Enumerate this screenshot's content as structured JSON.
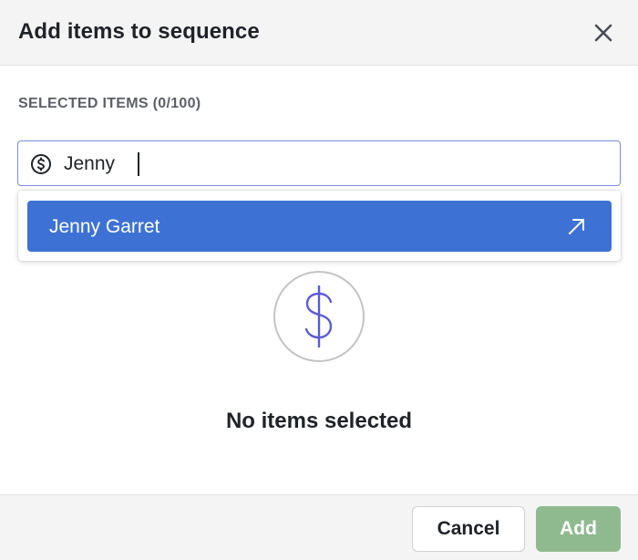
{
  "dialog": {
    "title": "Add items to sequence",
    "close_icon": "close-icon"
  },
  "selection": {
    "label": "SELECTED ITEMS (0/100)",
    "count": 0,
    "max": 100
  },
  "search": {
    "icon": "dollar-circle-icon",
    "value": "Jenny"
  },
  "dropdown": {
    "options": [
      {
        "label": "Jenny Garret",
        "icon": "arrow-up-right-icon",
        "highlighted": true
      }
    ]
  },
  "empty_state": {
    "icon": "dollar-icon",
    "text": "No items selected"
  },
  "footer": {
    "cancel_label": "Cancel",
    "add_label": "Add"
  },
  "colors": {
    "accent": "#3d72d4",
    "add_button_disabled": "#8fba8f",
    "input_focus_border": "#7a8fe0",
    "empty_icon": "#5b5bd6"
  }
}
